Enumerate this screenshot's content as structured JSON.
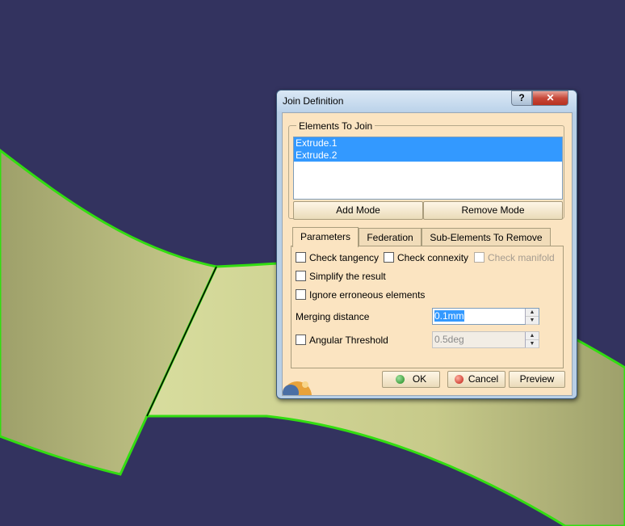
{
  "dialog": {
    "title": "Join Definition",
    "help_label": "?",
    "close_label": "✕",
    "elements_group_label": "Elements To Join",
    "elements": [
      "Extrude.1",
      "Extrude.2"
    ],
    "add_mode_label": "Add Mode",
    "remove_mode_label": "Remove Mode",
    "tabs": [
      "Parameters",
      "Federation",
      "Sub-Elements To Remove"
    ],
    "active_tab": "Parameters",
    "options": {
      "check_tangency": {
        "label": "Check tangency",
        "checked": false
      },
      "check_connexity": {
        "label": "Check connexity",
        "checked": false
      },
      "check_manifold": {
        "label": "Check manifold",
        "checked": false,
        "enabled": false
      },
      "simplify_result": {
        "label": "Simplify the result",
        "checked": false
      },
      "ignore_erroneous": {
        "label": "Ignore erroneous elements",
        "checked": false
      },
      "angular_threshold": {
        "label": "Angular Threshold",
        "checked": false
      }
    },
    "merging_distance_label": "Merging distance",
    "merging_distance_value": "0.1mm",
    "angular_threshold_value": "0.5deg",
    "ok_label": "OK",
    "cancel_label": "Cancel",
    "preview_label": "Preview"
  },
  "colors": {
    "background": "#33335f",
    "surface": "#d6db9c",
    "edge": "#33dd11",
    "dialog_client": "#fbe4c1",
    "selection": "#3399ff"
  }
}
